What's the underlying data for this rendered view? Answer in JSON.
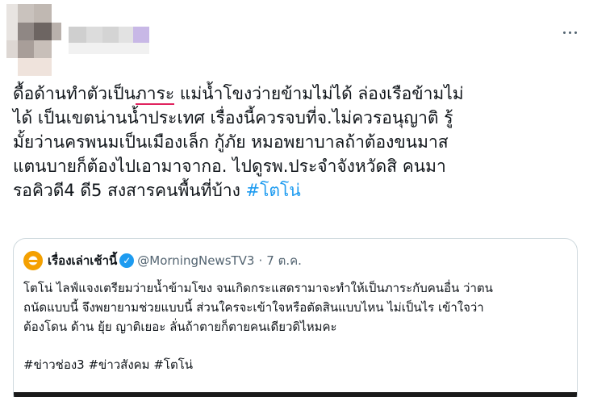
{
  "tweet": {
    "lines": [
      {
        "before": "ดื้อด้านทำตัวเป็น",
        "underline": "ภาระ",
        "after": " แม่น้ำโขงว่ายข้ามไม่ได้ ล่องเรือข้ามไม่"
      },
      {
        "text": "ได้ เป็นเขตน่านน้ำประเทศ เรื่องนี้ควรจบที่จ.ไม่ควรอนุญาติ รู้"
      },
      {
        "text": "มั้ยว่านครพนมเป็นเมืองเล็ก กู้ภัย หมอพยาบาลถ้าต้องขนมาส"
      },
      {
        "text": "แตนบายก็ต้องไปเอามาจากอ. ไปดูรพ.ประจำจังหวัดสิ คนมา"
      },
      {
        "text": "รอคิวดี4 ดี5 สงสารคนพื้นที่บ้าง ",
        "hashtag": "#โตโน่"
      }
    ]
  },
  "quote": {
    "name": "เรื่องเล่าเช้านี้",
    "verified_glyph": "✓",
    "handle": "@MorningNewsTV3",
    "separator": "·",
    "date": "7 ต.ค.",
    "body_lines": [
      "โตโน่ ไลฟ์แจงเตรียมว่ายน้ำข้ามโขง จนเกิดกระแสดรามาจะทำให้เป็นภาระกับคนอื่น ว่าตน",
      "ถนัดแบบนี้ จึงพยายามช่วยแบบนี้ ส่วนใครจะเข้าใจหรือตัดสินแบบไหน ไม่เป็นไร เข้าใจว่า",
      "ต้องโดน ด้าน ยุ้ย ญาติเยอะ ลั่นถ้าตายก็ตายคนเดียวดิไหมคะ"
    ],
    "tags": "#ข่าวช่อง3 #ข่าวสังคม #โตโน่"
  },
  "colors": {
    "text": "#0f1419",
    "secondary": "#536471",
    "accent": "#1d9bf0",
    "border": "#cfd9de",
    "underline": "#e0245e"
  },
  "icons": {
    "more": "more-horizontal-icon",
    "verified": "verified-badge-icon",
    "quote_avatar": "morning-news-logo-icon"
  }
}
